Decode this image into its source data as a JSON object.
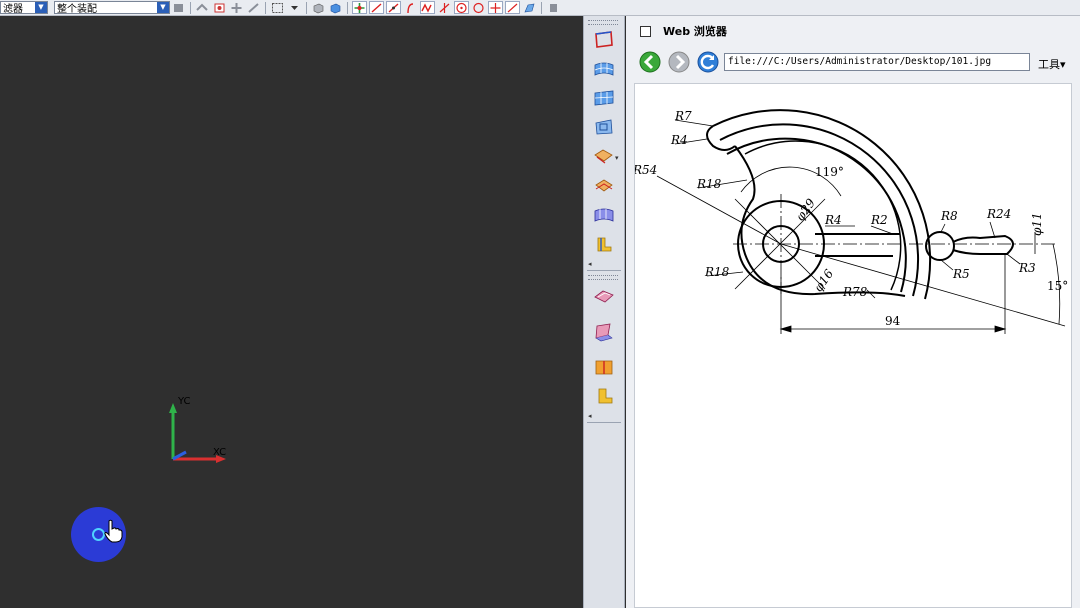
{
  "toolbar": {
    "filter_label": "滤器",
    "assembly_label": "整个装配"
  },
  "viewport": {
    "axis_y_label": "YC",
    "axis_x_label": "XC"
  },
  "web_panel": {
    "title": "Web 浏览器",
    "url": "file:///C:/Users/Administrator/Desktop/101.jpg",
    "tools_label": "工具",
    "tools_arrow": "▾"
  },
  "drawing": {
    "labels": {
      "r7": "R7",
      "r4_left": "R4",
      "r54": "R54",
      "r18_top": "R18",
      "angle_119": "119°",
      "phi29": "φ29",
      "r4_mid": "R4",
      "r2": "R2",
      "r8": "R8",
      "r24": "R24",
      "phi11": "φ11",
      "r18_bottom": "R18",
      "phi16": "φ16",
      "r5": "R5",
      "r3": "R3",
      "angle_15": "15°",
      "r78": "R78",
      "dim_94": "94"
    }
  },
  "colors": {
    "viewport_bg": "#2f2f2f",
    "axis_y": "#2fb34a",
    "axis_x": "#d93030",
    "cursor_dot": "#2b3bd6",
    "toolbar_bg": "#e9ecf1"
  }
}
